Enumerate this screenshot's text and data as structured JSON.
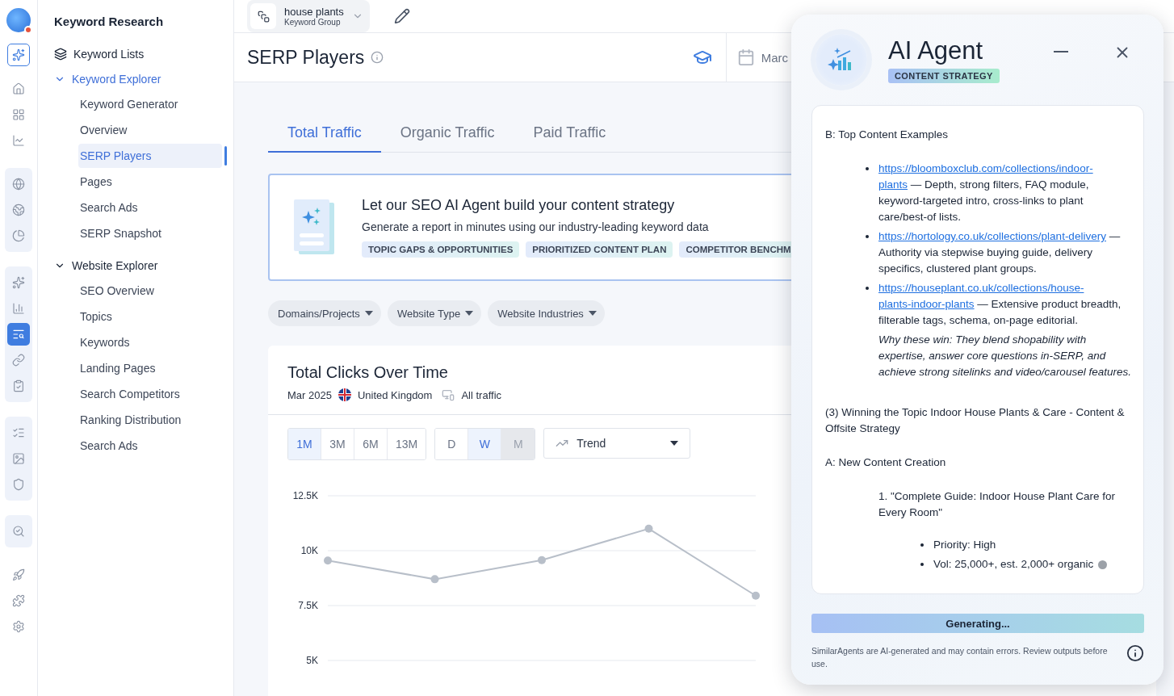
{
  "rail": {
    "groups": [
      {
        "kind": "plain",
        "items": [
          {
            "selected": false
          }
        ]
      },
      {
        "kind": "plain",
        "items": [
          {
            "selected": false
          },
          {
            "selected": false
          },
          {
            "selected": false
          }
        ]
      },
      {
        "kind": "shaded",
        "items": [
          {
            "selected": false
          },
          {
            "selected": false
          },
          {
            "selected": false
          }
        ]
      },
      {
        "kind": "shaded",
        "items": [
          {
            "selected": false
          },
          {
            "selected": false
          },
          {
            "selected": true
          },
          {
            "selected": false
          },
          {
            "selected": false
          }
        ]
      },
      {
        "kind": "shaded",
        "items": [
          {
            "selected": false
          },
          {
            "selected": false
          },
          {
            "selected": false
          }
        ]
      },
      {
        "kind": "shaded",
        "items": [
          {
            "selected": false
          }
        ]
      },
      {
        "kind": "plain",
        "items": [
          {
            "selected": false
          },
          {
            "selected": false
          },
          {
            "selected": false
          }
        ]
      }
    ]
  },
  "sidebar": {
    "title": "Keyword Research",
    "items": [
      {
        "label": "Keyword Lists",
        "selected": false
      },
      {
        "label": "Keyword Explorer",
        "selected": true,
        "expanded": true,
        "children": [
          {
            "label": "Keyword Generator",
            "selected": false
          },
          {
            "label": "Overview",
            "selected": false
          },
          {
            "label": "SERP Players",
            "selected": true
          },
          {
            "label": "Pages",
            "selected": false
          },
          {
            "label": "Search Ads",
            "selected": false
          },
          {
            "label": "SERP Snapshot",
            "selected": false
          }
        ]
      },
      {
        "label": "Website Explorer",
        "selected": false,
        "expanded": true,
        "children": [
          {
            "label": "SEO Overview",
            "selected": false
          },
          {
            "label": "Topics",
            "selected": false
          },
          {
            "label": "Keywords",
            "selected": false
          },
          {
            "label": "Landing Pages",
            "selected": false
          },
          {
            "label": "Search Competitors",
            "selected": false
          },
          {
            "label": "Ranking Distribution",
            "selected": false
          },
          {
            "label": "Search Ads",
            "selected": false
          }
        ]
      }
    ]
  },
  "keyword_group": {
    "name": "house plants",
    "type": "Keyword Group"
  },
  "page_title": "SERP Players",
  "date_picker": "Marc",
  "tabs": [
    {
      "label": "Total Traffic",
      "selected": true
    },
    {
      "label": "Organic Traffic",
      "selected": false
    },
    {
      "label": "Paid Traffic",
      "selected": false
    }
  ],
  "promo": {
    "title": "Let our SEO AI Agent build your content strategy",
    "description": "Generate a report in minutes using our industry-leading keyword data",
    "tags": [
      "TOPIC GAPS & OPPORTUNITIES",
      "PRIORITIZED CONTENT PLAN",
      "COMPETITOR BENCHM"
    ]
  },
  "filters": [
    "Domains/Projects",
    "Website Type",
    "Website Industries"
  ],
  "chart_card": {
    "title": "Total Clicks Over Time",
    "date": "Mar 2025",
    "country": "United Kingdom",
    "traffic": "All traffic",
    "ranges": [
      {
        "label": "1M",
        "selected": true
      },
      {
        "label": "3M",
        "selected": false
      },
      {
        "label": "6M",
        "selected": false
      },
      {
        "label": "13M",
        "selected": false
      }
    ],
    "granularity": [
      {
        "label": "D",
        "selected": false,
        "disabled": false
      },
      {
        "label": "W",
        "selected": true,
        "disabled": false
      },
      {
        "label": "M",
        "selected": false,
        "disabled": true
      }
    ],
    "view": "Trend",
    "chart_data": {
      "type": "line",
      "categories": [
        null,
        null,
        null,
        null,
        null
      ],
      "ylim": [
        5000,
        12500
      ],
      "yticks": [
        {
          "value": 12500,
          "label": "12.5K"
        },
        {
          "value": 10000,
          "label": "10K"
        },
        {
          "value": 7500,
          "label": "7.5K"
        },
        {
          "value": 5000,
          "label": "5K"
        }
      ],
      "series": [
        {
          "color": "#b8bfc9",
          "marker": "circle",
          "values": [
            9550,
            8700,
            9570,
            11000,
            7950
          ]
        }
      ]
    }
  },
  "agent": {
    "title": "AI Agent",
    "badge": "CONTENT STRATEGY",
    "content": [
      {
        "kind": "paragraph",
        "text": "B: Top Content Examples"
      },
      {
        "kind": "link_bullet",
        "url_lines": [
          "https://bloomboxclub.com/collections/indoor-",
          "plants"
        ],
        "text": "— Depth, strong filters, FAQ module, keyword-targeted intro, cross-links to plant care/best-of lists."
      },
      {
        "kind": "link_bullet",
        "url_lines": [
          "https://hortology.co.uk/collections/plant-delivery"
        ],
        "text": "— Authority via stepwise buying guide, delivery specifics, clustered plant groups."
      },
      {
        "kind": "link_bullet",
        "url_lines": [
          "https://houseplant.co.uk/collections/house-",
          "plants-indoor-plants"
        ],
        "text": "— Extensive product breadth, filterable tags, schema, on-page editorial."
      },
      {
        "kind": "note",
        "text": "Why these win: They blend shopability with expertise, answer core questions in-SERP, and achieve strong sitelinks and video/carousel features."
      },
      {
        "kind": "paragraph",
        "text": "(3) Winning the Topic Indoor House Plants & Care - Content & Offsite Strategy"
      },
      {
        "kind": "paragraph",
        "text": "A: New Content Creation"
      },
      {
        "kind": "numbered",
        "number": "1.",
        "text": "\"Complete Guide: Indoor House Plant Care for Every Room\""
      },
      {
        "kind": "sub_bullet",
        "text": "Priority: High"
      },
      {
        "kind": "sub_bullet",
        "text": "Vol: 25,000+, est. 2,000+ organic",
        "cursor": true
      }
    ],
    "status": "Generating...",
    "disclaimer": "SimilarAgents are AI-generated and may contain errors. Review outputs before use."
  }
}
